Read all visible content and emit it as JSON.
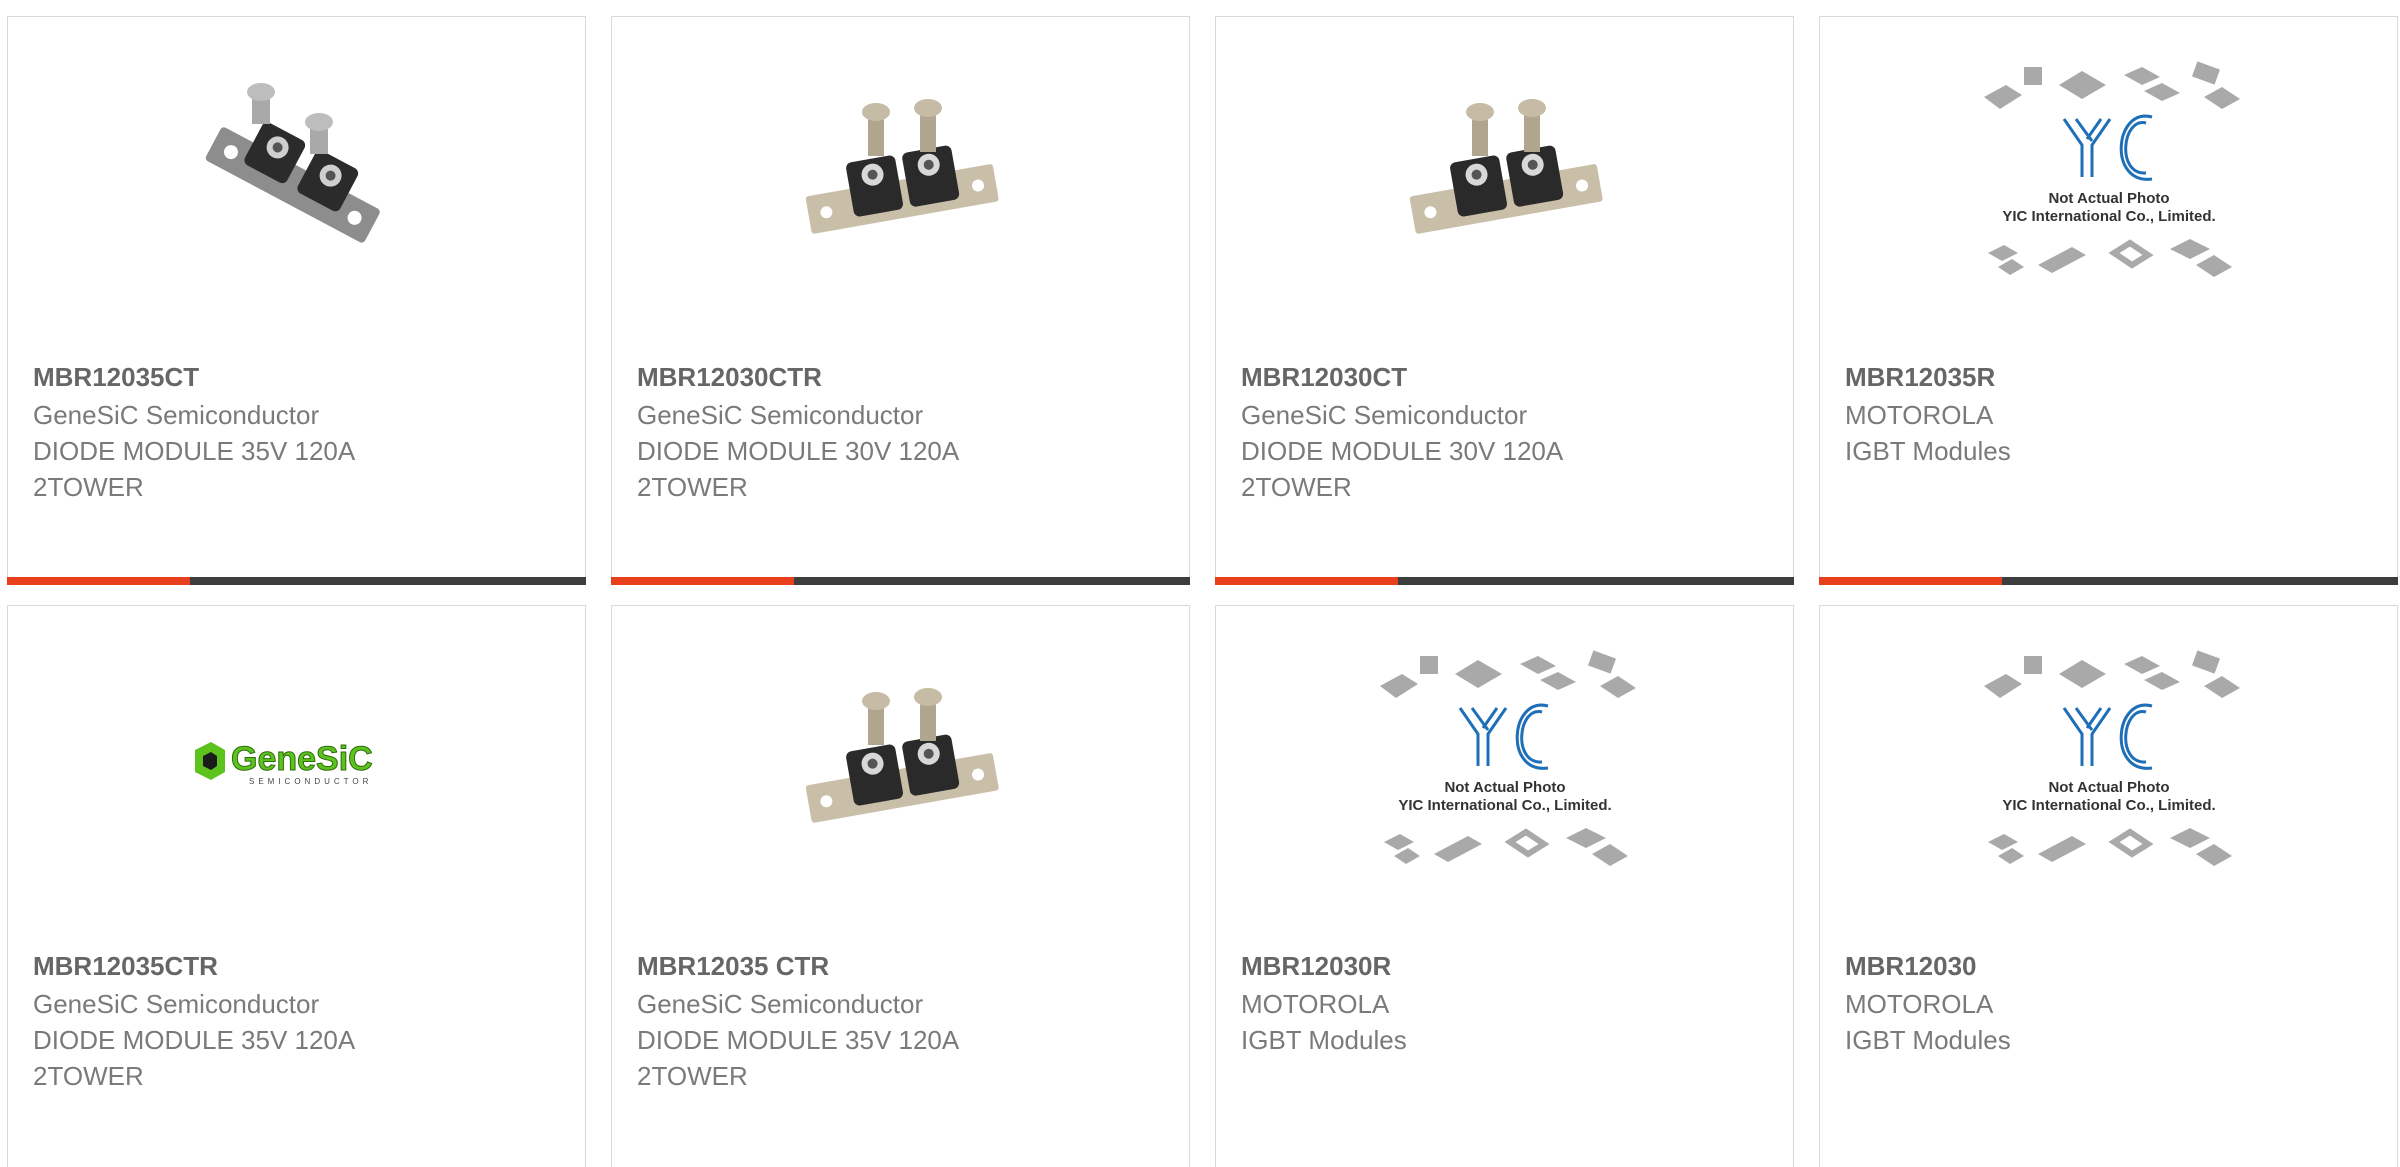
{
  "cards": [
    {
      "part": "MBR12035CT",
      "maker": "GeneSiC Semiconductor",
      "desc1": "DIODE MODULE 35V 120A",
      "desc2": "2TOWER",
      "image": "diode-module-photo"
    },
    {
      "part": "MBR12030CTR",
      "maker": "GeneSiC Semiconductor",
      "desc1": "DIODE MODULE 30V 120A",
      "desc2": "2TOWER",
      "image": "diode-module-photo"
    },
    {
      "part": "MBR12030CT",
      "maker": "GeneSiC Semiconductor",
      "desc1": "DIODE MODULE 30V 120A",
      "desc2": "2TOWER",
      "image": "diode-module-photo"
    },
    {
      "part": "MBR12035R",
      "maker": "MOTOROLA",
      "desc1": "IGBT Modules",
      "desc2": "",
      "image": "yic-placeholder"
    },
    {
      "part": "MBR12035CTR",
      "maker": "GeneSiC Semiconductor",
      "desc1": "DIODE MODULE 35V 120A",
      "desc2": "2TOWER",
      "image": "genesic-logo"
    },
    {
      "part": "MBR12035 CTR",
      "maker": "GeneSiC Semiconductor",
      "desc1": "DIODE MODULE 35V 120A",
      "desc2": "2TOWER",
      "image": "diode-module-photo"
    },
    {
      "part": "MBR12030R",
      "maker": "MOTOROLA",
      "desc1": "IGBT Modules",
      "desc2": "",
      "image": "yic-placeholder"
    },
    {
      "part": "MBR12030",
      "maker": "MOTOROLA",
      "desc1": "IGBT Modules",
      "desc2": "",
      "image": "yic-placeholder"
    }
  ],
  "placeholder_text": {
    "line1": "Not Actual Photo",
    "line2": "YIC International Co., Limited.",
    "logo": "YIC"
  },
  "genesic_logo": {
    "name": "GeneSiC",
    "tagline": "SEMICONDUCTOR"
  },
  "colors": {
    "accent": "#e8401c",
    "bar": "#3d3d3d",
    "text": "#7a7a7a",
    "yic_blue": "#1f6fb8",
    "genesic_green": "#5cc21e"
  }
}
